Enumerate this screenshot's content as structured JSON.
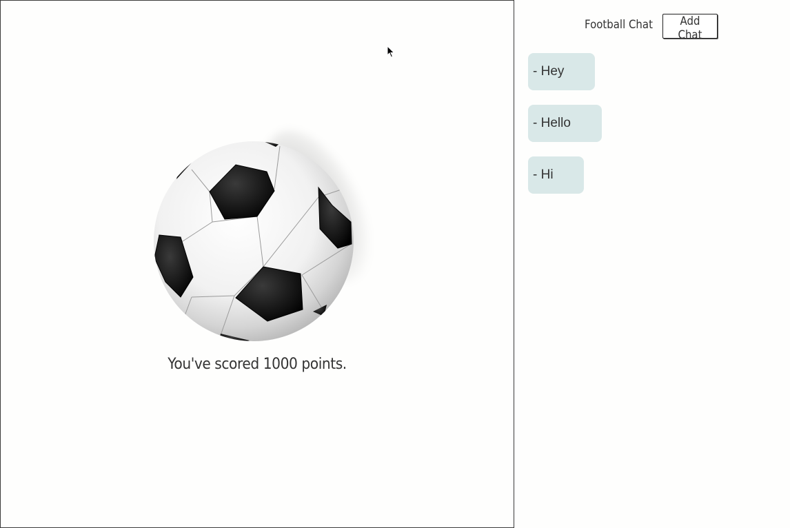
{
  "game": {
    "score_message": "You've scored 1000 points."
  },
  "header": {
    "title": "Football Chat",
    "add_chat_label": "Add Chat"
  },
  "chats": [
    {
      "label": "- Hey"
    },
    {
      "label": "- Hello"
    },
    {
      "label": "- Hi"
    }
  ],
  "colors": {
    "chat_bubble": "#d9e8e8",
    "panel_border": "#3a3a3a",
    "text": "#333333"
  }
}
